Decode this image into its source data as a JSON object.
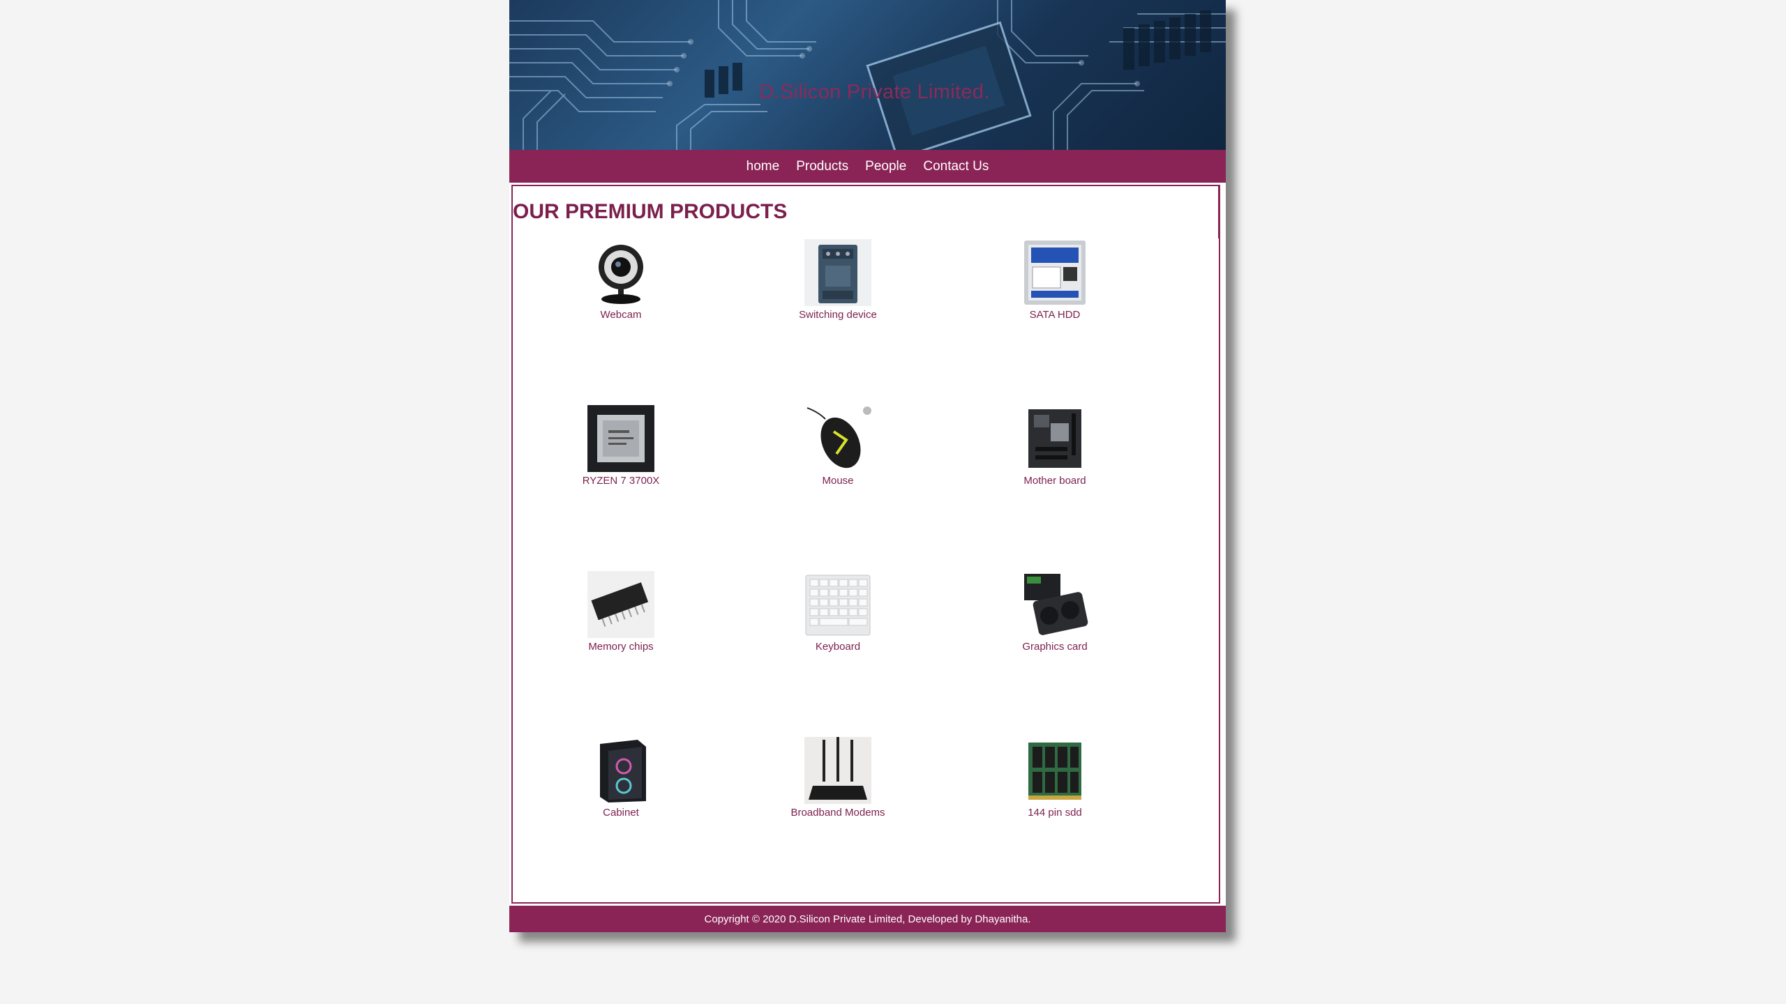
{
  "header": {
    "title": "D.Silicon Private Limited."
  },
  "nav": {
    "items": [
      {
        "label": "home"
      },
      {
        "label": "Products"
      },
      {
        "label": "People"
      },
      {
        "label": "Contact Us"
      }
    ]
  },
  "main": {
    "heading": "OUR PREMIUM PRODUCTS",
    "products": [
      {
        "label": "Webcam",
        "icon": "webcam-icon"
      },
      {
        "label": "Switching device",
        "icon": "switching-device-icon"
      },
      {
        "label": "SATA HDD",
        "icon": "hdd-icon"
      },
      {
        "label": "RYZEN 7 3700X",
        "icon": "cpu-icon"
      },
      {
        "label": "Mouse",
        "icon": "mouse-icon"
      },
      {
        "label": "Mother board",
        "icon": "motherboard-icon"
      },
      {
        "label": "Memory chips",
        "icon": "memory-chip-icon"
      },
      {
        "label": "Keyboard",
        "icon": "keyboard-icon"
      },
      {
        "label": "Graphics card",
        "icon": "graphics-card-icon"
      },
      {
        "label": "Cabinet",
        "icon": "cabinet-icon"
      },
      {
        "label": "Broadband Modems",
        "icon": "router-icon"
      },
      {
        "label": "144 pin sdd",
        "icon": "ram-module-icon"
      }
    ]
  },
  "footer": {
    "text": "Copyright © 2020 D.Silicon Private Limited, Developed by Dhayanitha."
  },
  "colors": {
    "brand": "#8a2456",
    "heading": "#7b1f4d",
    "background": "#f4f4f4"
  }
}
